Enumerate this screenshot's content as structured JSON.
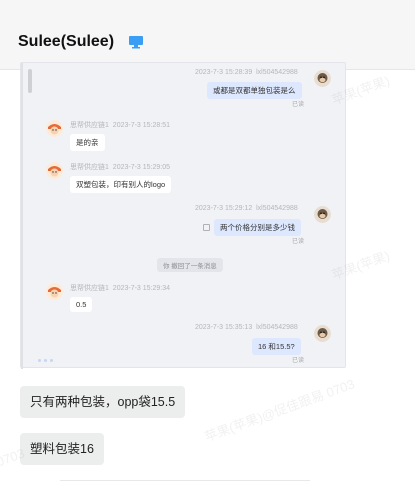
{
  "header": {
    "title": "Sulee(Sulee)",
    "device_icon": "monitor-icon",
    "device_icon_color": "#3a9ef5"
  },
  "preview": {
    "messages": [
      {
        "side": "right",
        "sender": "lxl504542988",
        "time": "2023-7-3 15:28:39",
        "text": "或都是双都单独包装是么",
        "status": "已读"
      },
      {
        "side": "left",
        "sender": "思帮供应链1",
        "time": "2023-7-3 15:28:51",
        "text": "是的亲"
      },
      {
        "side": "left",
        "sender": "思帮供应链1",
        "time": "2023-7-3 15:29:05",
        "text": "双塑包装，印有别人的logo"
      },
      {
        "side": "right",
        "sender": "lxl504542988",
        "time": "2023-7-3 15:29:12",
        "text": "两个价格分别是多少钱",
        "status": "已读"
      },
      {
        "side": "left",
        "sender": "思帮供应链1",
        "time": "2023-7-3 15:29:34",
        "text": "0.5"
      },
      {
        "side": "right",
        "sender": "lxl504542988",
        "time": "2023-7-3 15:35:13",
        "text": "16 和15.5?",
        "status": "已读"
      }
    ],
    "system_note": "你 撤回了一条消息"
  },
  "replies": [
    {
      "text": "只有两种包装，opp袋15.5"
    },
    {
      "text": "塑料包装16"
    }
  ],
  "watermarks": [
    "苹果(苹果)@促佳跟易 0703",
    "苹果(苹果)@促佳跟易 0703",
    "苹果(苹果)",
    "0703"
  ],
  "colors": {
    "left_bubble": "#ffffff",
    "right_bubble": "#dde8ff",
    "reply_bg": "#eceded"
  }
}
